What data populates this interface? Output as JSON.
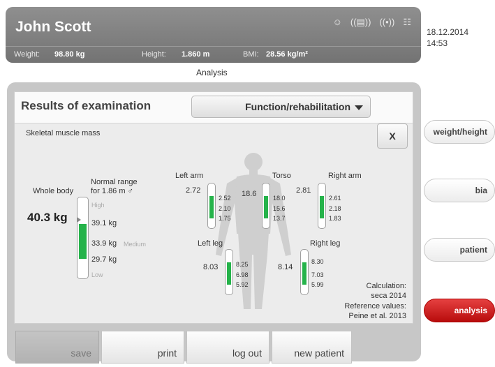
{
  "header": {
    "name": "John Scott",
    "weight_label": "Weight:",
    "weight_value": "98.80 kg",
    "height_label": "Height:",
    "height_value": "1.860 m",
    "bmi_label": "BMI:",
    "bmi_value": "28.56 kg/m²",
    "icons": [
      "person-icon",
      "printer-wireless-icon",
      "wireless-signal-icon",
      "network-icon"
    ]
  },
  "datetime": {
    "date": "18.12.2014",
    "time": "14:53"
  },
  "tab_title": "Analysis",
  "results": {
    "title": "Results of examination",
    "dropdown_value": "Function/rehabilitation",
    "metric": "Skeletal muscle mass",
    "close_label": "X"
  },
  "whole_body": {
    "label": "Whole body",
    "value": "40.3 kg",
    "range_title_1": "Normal range",
    "range_title_2": "for 1.86 m ♂",
    "high": "High",
    "medium": "Medium",
    "low": "Low",
    "upper": "39.1 kg",
    "mid": "33.9 kg",
    "lower": "29.7 kg"
  },
  "segments": {
    "left_arm": {
      "label": "Left arm",
      "value": "2.72",
      "upper": "2.52",
      "mid": "2.10",
      "lower": "1.75"
    },
    "torso": {
      "label": "Torso",
      "value": "18.6",
      "upper": "18.0",
      "mid": "15.6",
      "lower": "13.7"
    },
    "right_arm": {
      "label": "Right arm",
      "value": "2.81",
      "upper": "2.61",
      "mid": "2.18",
      "lower": "1.83"
    },
    "left_leg": {
      "label": "Left leg",
      "value": "8.03",
      "upper": "8.25",
      "mid": "6.98",
      "lower": "5.92"
    },
    "right_leg": {
      "label": "Right leg",
      "value": "8.14",
      "upper": "8.30",
      "mid": "7.03",
      "lower": "5.99"
    }
  },
  "reference": {
    "line1": "Calculation:",
    "line2": "seca 2014",
    "line3": "Reference values:",
    "line4": "Peine et al. 2013"
  },
  "side_nav": {
    "weight_height": "weight/height",
    "bia": "bia",
    "patient": "patient",
    "analysis": "analysis"
  },
  "bottom": {
    "save": "save",
    "print": "print",
    "logout": "log out",
    "new_patient": "new patient"
  },
  "colors": {
    "accent_active": "#c81414",
    "gauge_fill": "#25b34a",
    "header_bg": "#7f7f7f"
  }
}
